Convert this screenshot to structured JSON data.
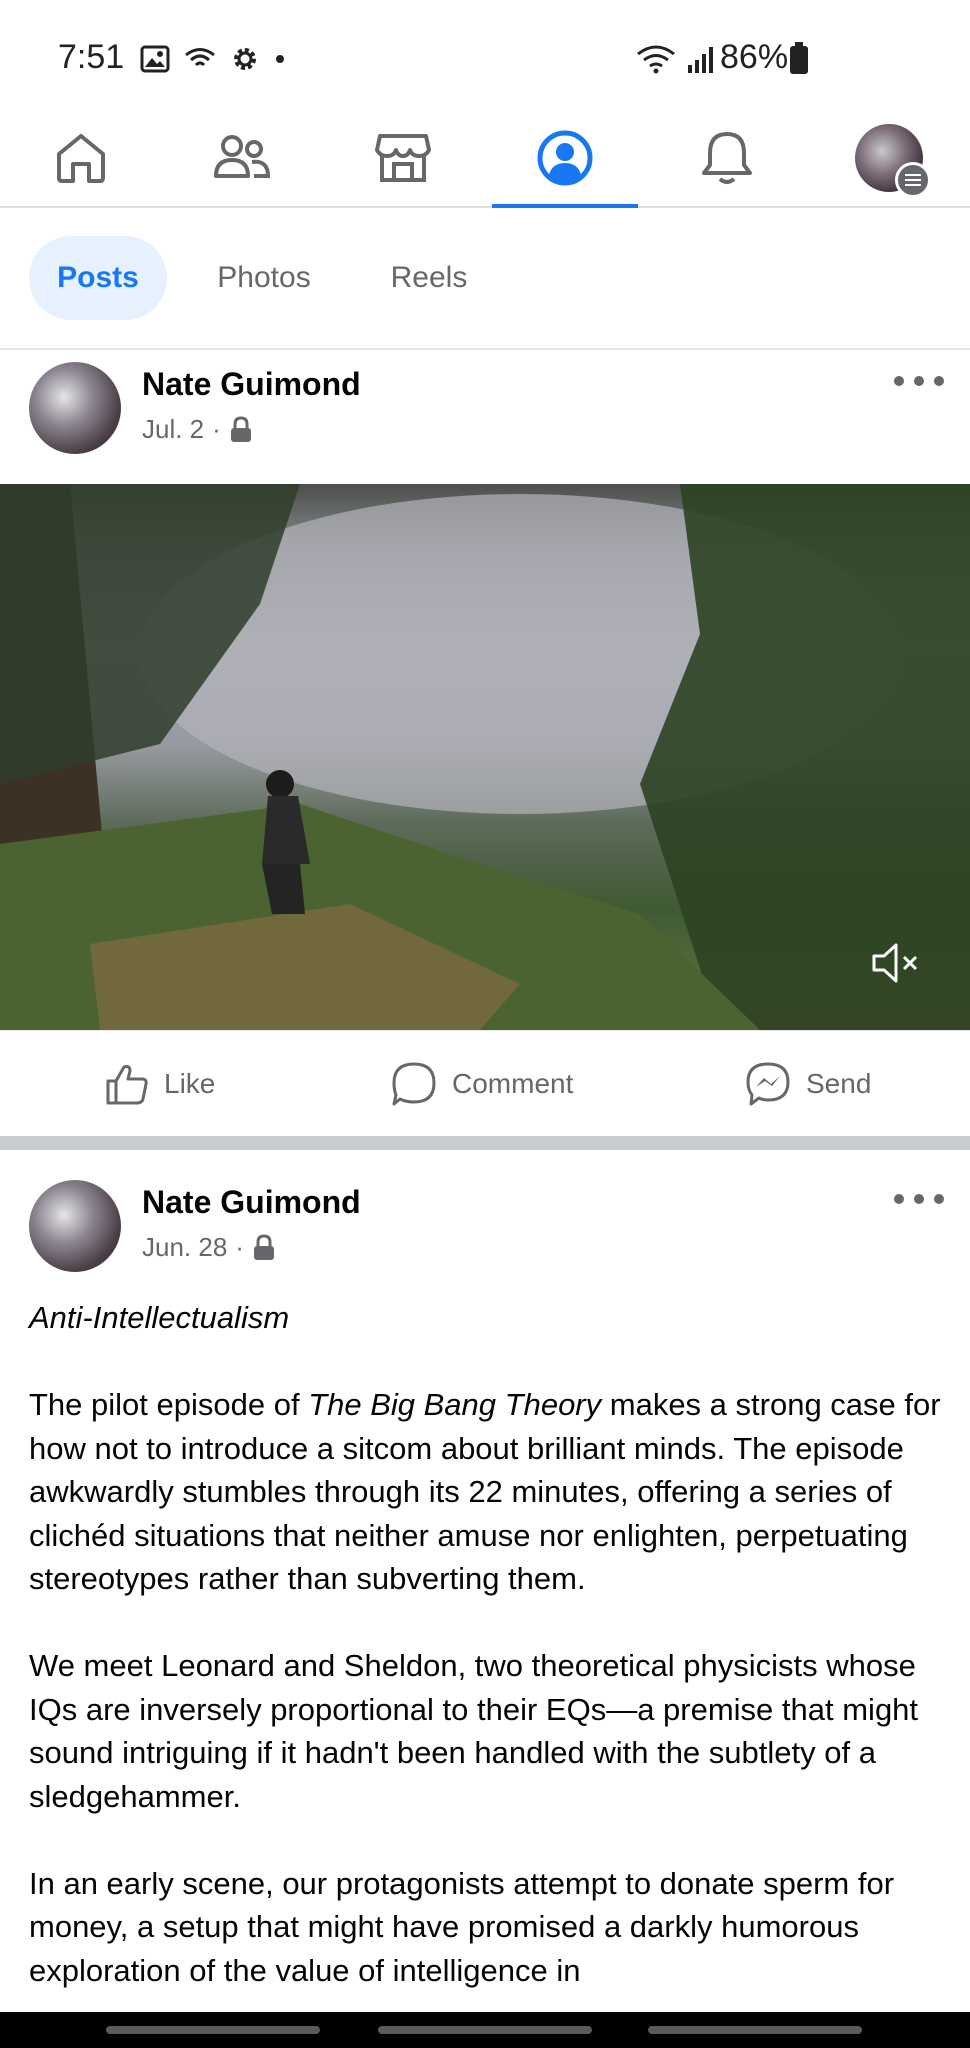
{
  "status_bar": {
    "time": "7:51",
    "battery": "86%"
  },
  "nav": {
    "items": [
      {
        "name": "home",
        "icon": "home-icon"
      },
      {
        "name": "friends",
        "icon": "friends-icon"
      },
      {
        "name": "marketplace",
        "icon": "marketplace-icon"
      },
      {
        "name": "profile",
        "icon": "profile-icon",
        "active": true
      },
      {
        "name": "notifications",
        "icon": "bell-icon"
      },
      {
        "name": "menu",
        "icon": "avatar-menu-icon"
      }
    ]
  },
  "tabs": {
    "posts": "Posts",
    "photos": "Photos",
    "reels": "Reels",
    "active": "Posts"
  },
  "posts": [
    {
      "author": "Nate Guimond",
      "date": "Jul. 2",
      "separator": "·",
      "privacy_icon": "lock-icon",
      "media": "video",
      "actions": {
        "like": "Like",
        "comment": "Comment",
        "send": "Send"
      }
    },
    {
      "author": "Nate Guimond",
      "date": "Jun. 28",
      "separator": "·",
      "privacy_icon": "lock-icon",
      "title": "Anti-Intellectualism",
      "para1_pre": "The pilot episode of ",
      "para1_em": "The Big Bang Theory",
      "para1_post": " makes a strong case for how not to introduce a sitcom about brilliant minds. The episode awkwardly stumbles through its 22 minutes, offering a series of clichéd situations that neither amuse nor enlighten, perpetuating stereotypes rather than subverting them.",
      "para2": "We meet Leonard and Sheldon, two theoretical physicists whose IQs are inversely proportional to their EQs—a premise that might sound intriguing if it hadn't been handled with the subtlety of a sledgehammer.",
      "para3": "In an early scene, our protagonists attempt to donate sperm for money, a setup that might have promised a darkly humorous exploration of the value of intelligence in"
    }
  ],
  "colors": {
    "accent": "#1877f2",
    "active_tab_bg": "#e7f0fd",
    "muted_text": "#65676b",
    "divider": "#c9ccd1"
  }
}
